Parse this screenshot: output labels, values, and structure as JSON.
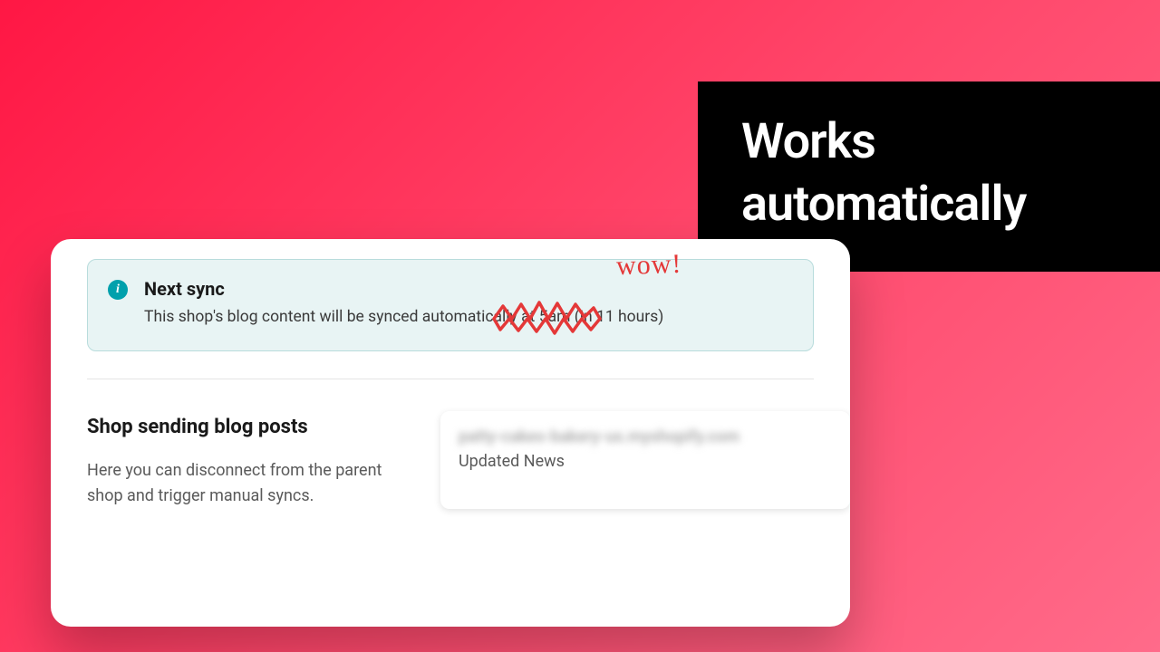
{
  "headline": "Works automatically",
  "banner": {
    "title": "Next sync",
    "description": "This shop's blog content will be synced automatically at 5am (in 11 hours)"
  },
  "section": {
    "title": "Shop sending blog posts",
    "description": "Here you can disconnect from the parent shop and trigger manual syncs."
  },
  "shop": {
    "url_blurred": "patty-cakes-bakery-us.myshopify.com",
    "subtitle": "Updated News"
  },
  "annotation": {
    "wow": "wow!"
  }
}
